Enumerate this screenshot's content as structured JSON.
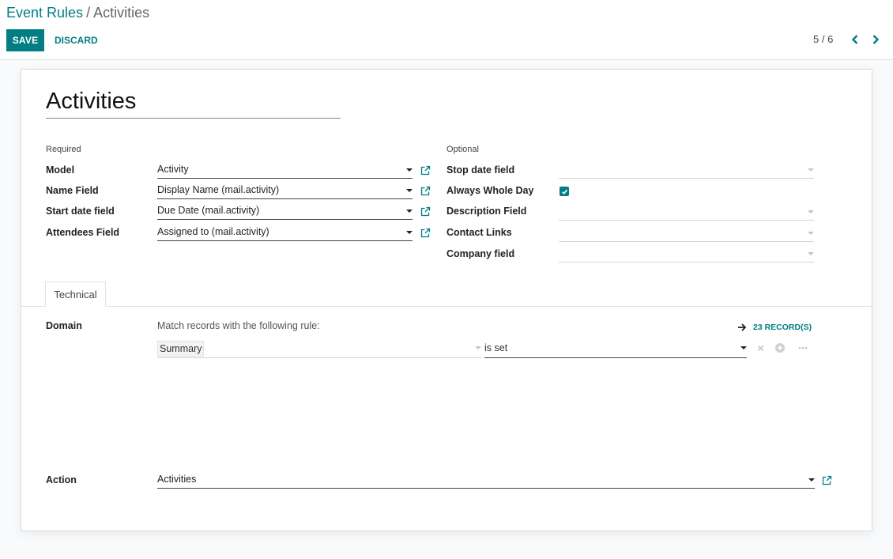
{
  "breadcrumb": {
    "parent": "Event Rules",
    "separator": "/",
    "current": "Activities"
  },
  "toolbar": {
    "save_label": "SAVE",
    "discard_label": "DISCARD"
  },
  "pager": {
    "value": "5 / 6"
  },
  "record": {
    "title": "Activities"
  },
  "groups": {
    "required": "Required",
    "optional": "Optional"
  },
  "required_fields": [
    {
      "label": "Model",
      "value": "Activity"
    },
    {
      "label": "Name Field",
      "value": "Display Name (mail.activity)"
    },
    {
      "label": "Start date field",
      "value": "Due Date (mail.activity)"
    },
    {
      "label": "Attendees Field",
      "value": "Assigned to (mail.activity)"
    }
  ],
  "optional_fields": [
    {
      "label": "Stop date field",
      "value": ""
    },
    {
      "label": "Always Whole Day",
      "checked": true
    },
    {
      "label": "Description Field",
      "value": ""
    },
    {
      "label": "Contact Links",
      "value": ""
    },
    {
      "label": "Company field",
      "value": ""
    }
  ],
  "tabs": [
    {
      "label": "Technical",
      "active": true
    }
  ],
  "domain": {
    "label": "Domain",
    "description": "Match records with the following rule:",
    "records_label": "23 RECORD(S)",
    "field": "Summary",
    "operator": "is set"
  },
  "action": {
    "label": "Action",
    "value": "Activities"
  },
  "colors": {
    "accent": "#017e84",
    "background": "#f9fafb",
    "sheet": "#ffffff"
  }
}
